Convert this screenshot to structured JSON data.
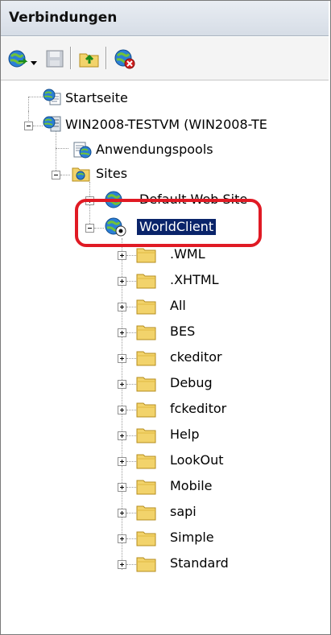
{
  "panel": {
    "title": "Verbindungen"
  },
  "toolbar": {
    "icons": [
      "connect-globe-icon",
      "dropdown-arrow-icon",
      "save-icon",
      "up-folder-icon",
      "disconnect-icon"
    ]
  },
  "tree": {
    "startseite": "Startseite",
    "server": "WIN2008-TESTVM (WIN2008-TE",
    "app_pools": "Anwendungspools",
    "sites": "Sites",
    "default_site": "Default Web Site",
    "worldclient": "WorldClient",
    "folders": [
      ".WML",
      ".XHTML",
      "All",
      "BES",
      "ckeditor",
      "Debug",
      "fckeditor",
      "Help",
      "LookOut",
      "Mobile",
      "sapi",
      "Simple",
      "Standard"
    ]
  },
  "colors": {
    "selection": "#0a246a",
    "highlight_ring": "#e01a24",
    "folder": "#f2d36b"
  }
}
